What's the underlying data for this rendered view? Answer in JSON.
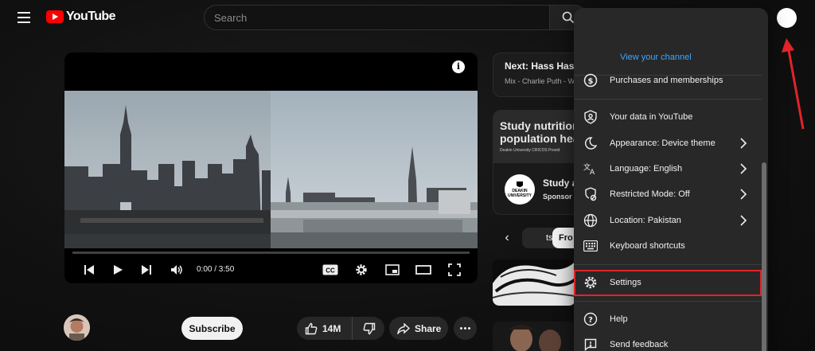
{
  "masthead": {
    "logo_text": "YouTube",
    "search_placeholder": "Search"
  },
  "player": {
    "time": "0:00 / 3:50",
    "info_glyph": "i",
    "cc_label": "CC"
  },
  "owner_row": {
    "subscribe_label": "Subscribe",
    "like_count": "14M",
    "share_label": "Share"
  },
  "up_next": {
    "title": "Next: Hass Hass",
    "subtitle": "Mix - Charlie Puth - W"
  },
  "ad": {
    "banner_line1": "Study nutrition",
    "banner_line2": "population hea",
    "banner_small": "Deakin University CRICOS Provid",
    "logo_line1": "DEAKIN",
    "logo_line2": "UNIVERSITY",
    "title": "Study a",
    "sponsor": "Sponsor"
  },
  "chips": {
    "chip_1": "ts",
    "chip_2": "Fro"
  },
  "account_menu": {
    "view_channel": "View your channel",
    "items": [
      {
        "label": "Purchases and memberships",
        "icon": "dollar-circle-icon",
        "chevron": false
      },
      {
        "label": "Your data in YouTube",
        "icon": "shield-person-icon",
        "chevron": false
      },
      {
        "label": "Appearance: Device theme",
        "icon": "moon-icon",
        "chevron": true
      },
      {
        "label": "Language: English",
        "icon": "translate-icon",
        "chevron": true
      },
      {
        "label": "Restricted Mode: Off",
        "icon": "restricted-icon",
        "chevron": true
      },
      {
        "label": "Location: Pakistan",
        "icon": "globe-icon",
        "chevron": true
      },
      {
        "label": "Keyboard shortcuts",
        "icon": "keyboard-icon",
        "chevron": false
      },
      {
        "label": "Settings",
        "icon": "gear-icon",
        "chevron": false
      },
      {
        "label": "Help",
        "icon": "help-icon",
        "chevron": false
      },
      {
        "label": "Send feedback",
        "icon": "feedback-icon",
        "chevron": false
      }
    ]
  },
  "colors": {
    "accent_red": "#ff0000",
    "highlight_red": "#e0242a",
    "link_blue": "#3ea6ff",
    "menu_bg": "#282828"
  }
}
